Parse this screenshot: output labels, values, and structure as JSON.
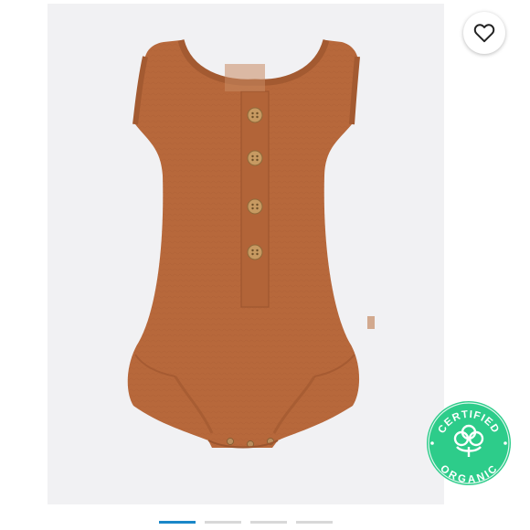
{
  "product": {
    "image_label": "Product photo of a sleeveless rust-orange gauze baby bodysuit with four front buttons",
    "garment_color": "#b7683b",
    "background_color": "#f1f1f3"
  },
  "favorite": {
    "icon": "heart-icon"
  },
  "badge": {
    "line_top": "CERTIFIED",
    "line_bottom": "ORGANIC",
    "icon": "cotton-icon",
    "color": "#2dcc8a"
  },
  "gallery": {
    "slide_count": 4,
    "active_index": 0,
    "accent_color": "#1a87c8"
  }
}
